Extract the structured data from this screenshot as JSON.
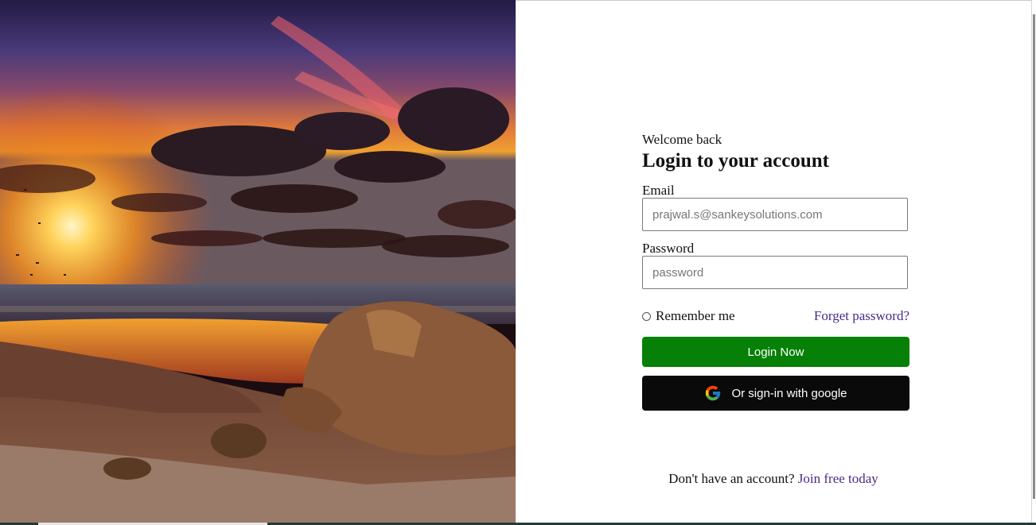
{
  "hero": {
    "image_alt": "sunset-over-rocky-beach"
  },
  "form": {
    "welcome": "Welcome back",
    "title": "Login to your account",
    "email_label": "Email",
    "email_placeholder": "prajwal.s@sankeysolutions.com",
    "password_label": "Password",
    "password_placeholder": "password",
    "remember_label": "Remember me",
    "forgot_link": "Forget password?",
    "login_button": "Login Now",
    "google_button": "Or sign-in with google",
    "signup_prompt": "Don't have an account?",
    "signup_link": "Join free today"
  },
  "colors": {
    "login_button": "#068006",
    "google_button": "#0a0a0a",
    "link": "#4b2a86"
  },
  "icons": {
    "google": "google-g-icon"
  }
}
